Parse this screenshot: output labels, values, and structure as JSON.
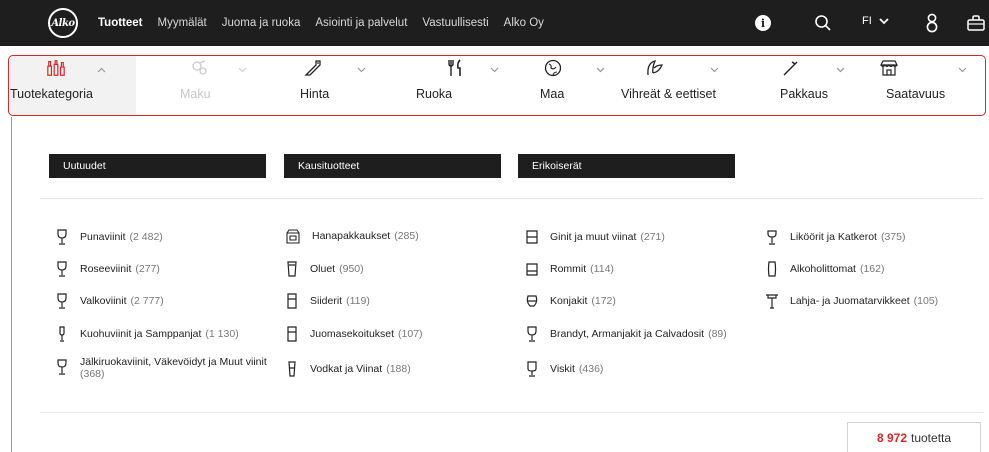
{
  "topnav": {
    "logo": "Alko",
    "links": [
      {
        "label": "Tuotteet",
        "active": true
      },
      {
        "label": "Myymälät",
        "active": false
      },
      {
        "label": "Juoma ja ruoka",
        "active": false
      },
      {
        "label": "Asiointi ja palvelut",
        "active": false
      },
      {
        "label": "Vastuullisesti",
        "active": false
      },
      {
        "label": "Alko Oy",
        "active": false
      }
    ],
    "language": "FI",
    "icons": [
      "info-icon",
      "search-icon",
      "chevron-down-icon",
      "user-icon",
      "shopping-bag-icon"
    ]
  },
  "filters": [
    {
      "label": "Tuotekategoria",
      "icon": "bottles-icon",
      "active": true,
      "chevron": "up"
    },
    {
      "label": "Maku",
      "icon": "taste-icon",
      "disabled": true,
      "chevron": "down"
    },
    {
      "label": "Hinta",
      "icon": "price-tag-icon",
      "chevron": "down"
    },
    {
      "label": "Ruoka",
      "icon": "cutlery-icon",
      "chevron": "down"
    },
    {
      "label": "Maa",
      "icon": "globe-icon",
      "chevron": "down"
    },
    {
      "label": "Vihreät & eettiset",
      "icon": "leaf-icon",
      "chevron": "down"
    },
    {
      "label": "Pakkaus",
      "icon": "package-icon",
      "chevron": "down"
    },
    {
      "label": "Saatavuus",
      "icon": "store-icon",
      "chevron": "down"
    }
  ],
  "tags": [
    "Uutuudet",
    "Kausituotteet",
    "Erikoiserät"
  ],
  "categories": {
    "col1": [
      {
        "name": "Punaviinit",
        "count": "(2 482)",
        "icon": "wine-glass-icon"
      },
      {
        "name": "Roseeviinit",
        "count": "(277)",
        "icon": "wine-glass-icon"
      },
      {
        "name": "Valkoviinit",
        "count": "(2 777)",
        "icon": "wine-glass-icon"
      },
      {
        "name": "Kuohuviinit ja Samppanjat",
        "count": "(1 130)",
        "icon": "champagne-glass-icon"
      },
      {
        "name": "Jälkiruokaviinit, Väkevöidyt ja Muut viinit",
        "count": "(368)",
        "icon": "dessert-wine-glass-icon"
      }
    ],
    "col2": [
      {
        "name": "Hanapakkaukset",
        "count": "(285)",
        "icon": "bag-in-box-icon"
      },
      {
        "name": "Oluet",
        "count": "(950)",
        "icon": "beer-glass-icon"
      },
      {
        "name": "Siiderit",
        "count": "(119)",
        "icon": "cider-glass-icon"
      },
      {
        "name": "Juomasekoitukset",
        "count": "(107)",
        "icon": "cider-glass-icon"
      },
      {
        "name": "Vodkat ja Viinat",
        "count": "(188)",
        "icon": "shot-glass-icon"
      }
    ],
    "col3": [
      {
        "name": "Ginit ja muut viinat",
        "count": "(271)",
        "icon": "tumbler-icon"
      },
      {
        "name": "Rommit",
        "count": "(114)",
        "icon": "tumbler-icon"
      },
      {
        "name": "Konjakit",
        "count": "(172)",
        "icon": "snifter-icon"
      },
      {
        "name": "Brandyt, Armanjakit ja Calvadosit",
        "count": "(89)",
        "icon": "brandy-glass-icon"
      },
      {
        "name": "Viskit",
        "count": "(436)",
        "icon": "whisky-glass-icon"
      }
    ],
    "col4": [
      {
        "name": "Liköörit ja Katkerot",
        "count": "(375)",
        "icon": "liqueur-glass-icon"
      },
      {
        "name": "Alkoholittomat",
        "count": "(162)",
        "icon": "tall-glass-icon"
      },
      {
        "name": "Lahja- ja Juomatarvikkeet",
        "count": "(105)",
        "icon": "cocktail-glass-icon"
      }
    ]
  },
  "result": {
    "count": "8 972",
    "label": "tuotetta"
  },
  "colors": {
    "topbar": "#1e1e1e",
    "accent": "#d62828",
    "tag_bg": "#1e1e1e"
  }
}
